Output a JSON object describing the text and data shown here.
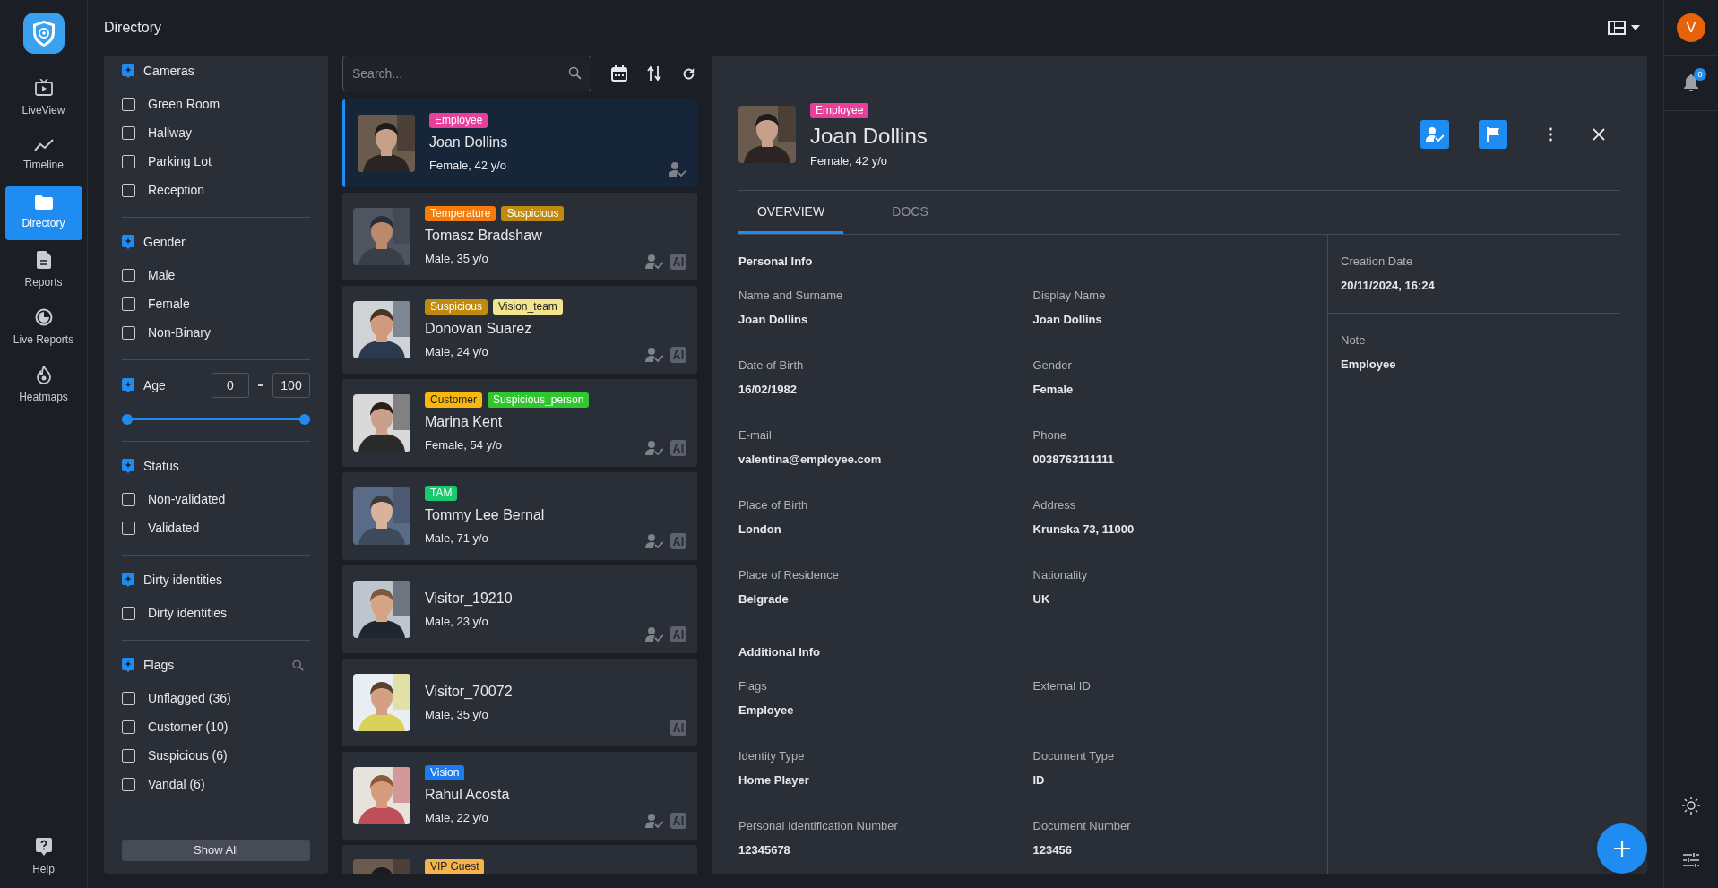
{
  "nav": {
    "items": [
      {
        "label": "LiveView",
        "selected": false
      },
      {
        "label": "Timeline",
        "selected": false
      },
      {
        "label": "Directory",
        "selected": true
      },
      {
        "label": "Reports",
        "selected": false
      },
      {
        "label": "Live Reports",
        "selected": false
      },
      {
        "label": "Heatmaps",
        "selected": false
      }
    ],
    "help": "Help"
  },
  "header": {
    "title": "Directory"
  },
  "filters": {
    "sections": [
      {
        "kind": "checklist",
        "title": "Cameras",
        "items": [
          {
            "label": "Green Room",
            "checked": false
          },
          {
            "label": "Hallway",
            "checked": false
          },
          {
            "label": "Parking Lot",
            "checked": false
          },
          {
            "label": "Reception",
            "checked": false
          }
        ]
      },
      {
        "kind": "checklist",
        "title": "Gender",
        "items": [
          {
            "label": "Male",
            "checked": false
          },
          {
            "label": "Female",
            "checked": false
          },
          {
            "label": "Non-Binary",
            "checked": false
          }
        ]
      },
      {
        "kind": "range",
        "title": "Age",
        "min": "0",
        "max": "100",
        "thumbs": [
          {
            "level": 0
          },
          {
            "level": 1
          }
        ]
      },
      {
        "kind": "checklist",
        "title": "Status",
        "items": [
          {
            "label": "Non-validated",
            "checked": false
          },
          {
            "label": "Validated",
            "checked": false
          }
        ]
      },
      {
        "kind": "checklist",
        "title": "Dirty identities",
        "items": [
          {
            "label": "Dirty identities",
            "checked": false
          }
        ]
      },
      {
        "kind": "checklist",
        "title": "Flags",
        "searchable": true,
        "items": [
          {
            "label": "Unflagged (36)",
            "checked": false
          },
          {
            "label": "Customer (10)",
            "checked": false
          },
          {
            "label": "Suspicious (6)",
            "checked": false
          },
          {
            "label": "Vandal (6)",
            "checked": false
          }
        ]
      }
    ],
    "show_all": "Show All"
  },
  "list": {
    "search": {
      "placeholder": "Search..."
    },
    "people": [
      {
        "tags": [
          {
            "label": "Employee",
            "color": "#e83f9a"
          }
        ],
        "name": "Joan Dollins",
        "meta": "Female, 42 y/o",
        "selected": true,
        "validated": true,
        "ai": false
      },
      {
        "tags": [
          {
            "label": "Temperature",
            "color": "#f57b0c"
          },
          {
            "label": "Suspicious",
            "color": "#c08a0e"
          }
        ],
        "name": "Tomasz Bradshaw",
        "meta": "Male, 35 y/o",
        "selected": false,
        "validated": true,
        "ai": true
      },
      {
        "tags": [
          {
            "label": "Suspicious",
            "color": "#c08a0e"
          },
          {
            "label": "Vision_team",
            "color": "#f3e58c"
          }
        ],
        "name": "Donovan Suarez",
        "meta": "Male, 24 y/o",
        "selected": false,
        "validated": true,
        "ai": true
      },
      {
        "tags": [
          {
            "label": "Customer",
            "color": "#f7b70c"
          },
          {
            "label": "Suspicious_person",
            "color": "#2ec72e"
          }
        ],
        "name": "Marina Kent",
        "meta": "Female, 54 y/o",
        "selected": false,
        "validated": true,
        "ai": true
      },
      {
        "tags": [
          {
            "label": "TAM",
            "color": "#18c96e"
          }
        ],
        "name": "Tommy Lee Bernal",
        "meta": "Male, 71 y/o",
        "selected": false,
        "validated": true,
        "ai": true
      },
      {
        "name": "Visitor_19210",
        "meta": "Male, 23 y/o",
        "selected": false,
        "validated": true,
        "ai": true
      },
      {
        "name": "Visitor_70072",
        "meta": "Male, 35 y/o",
        "selected": false,
        "validated": false,
        "ai": true
      },
      {
        "tags": [
          {
            "label": "Vision",
            "color": "#1a7cf0"
          }
        ],
        "name": "Rahul Acosta",
        "meta": "Male, 22 y/o",
        "selected": false,
        "validated": true,
        "ai": true
      },
      {
        "tags": [
          {
            "label": "VIP Guest",
            "color": "#f5b34a"
          }
        ],
        "selected": false
      }
    ]
  },
  "detail": {
    "tag": {
      "label": "Employee",
      "color": "#e83f9a"
    },
    "name": "Joan Dollins",
    "meta": "Female, 42 y/o",
    "tabs": [
      {
        "label": "OVERVIEW",
        "selected": true
      },
      {
        "label": "DOCS",
        "selected": false
      }
    ],
    "sections": [
      {
        "title": "Personal Info",
        "fields": [
          {
            "label": "Name and Surname",
            "value": "Joan Dollins"
          },
          {
            "label": "Display Name",
            "value": "Joan Dollins"
          },
          {
            "label": "Date of Birth",
            "value": "16/02/1982"
          },
          {
            "label": "Gender",
            "value": "Female"
          },
          {
            "label": "E-mail",
            "value": "valentina@employee.com"
          },
          {
            "label": "Phone",
            "value": "0038763111111"
          },
          {
            "label": "Place of Birth",
            "value": "London"
          },
          {
            "label": "Address",
            "value": "Krunska 73, 11000"
          },
          {
            "label": "Place of Residence",
            "value": "Belgrade"
          },
          {
            "label": "Nationality",
            "value": "UK"
          }
        ]
      },
      {
        "title": "Additional Info",
        "fields": [
          {
            "label": "Flags",
            "value": "Employee"
          },
          {
            "label": "External ID"
          },
          {
            "label": "Identity Type",
            "value": "Home Player"
          },
          {
            "label": "Document Type",
            "value": "ID"
          },
          {
            "label": "Personal Identification Number",
            "value": "12345678"
          },
          {
            "label": "Document Number",
            "value": "123456"
          }
        ]
      }
    ],
    "side": [
      {
        "label": "Creation Date",
        "value": "20/11/2024, 16:24"
      },
      {
        "label": "Note",
        "value": "Employee"
      }
    ]
  },
  "user": {
    "initial": "V"
  },
  "notifications": {
    "count": "0"
  }
}
